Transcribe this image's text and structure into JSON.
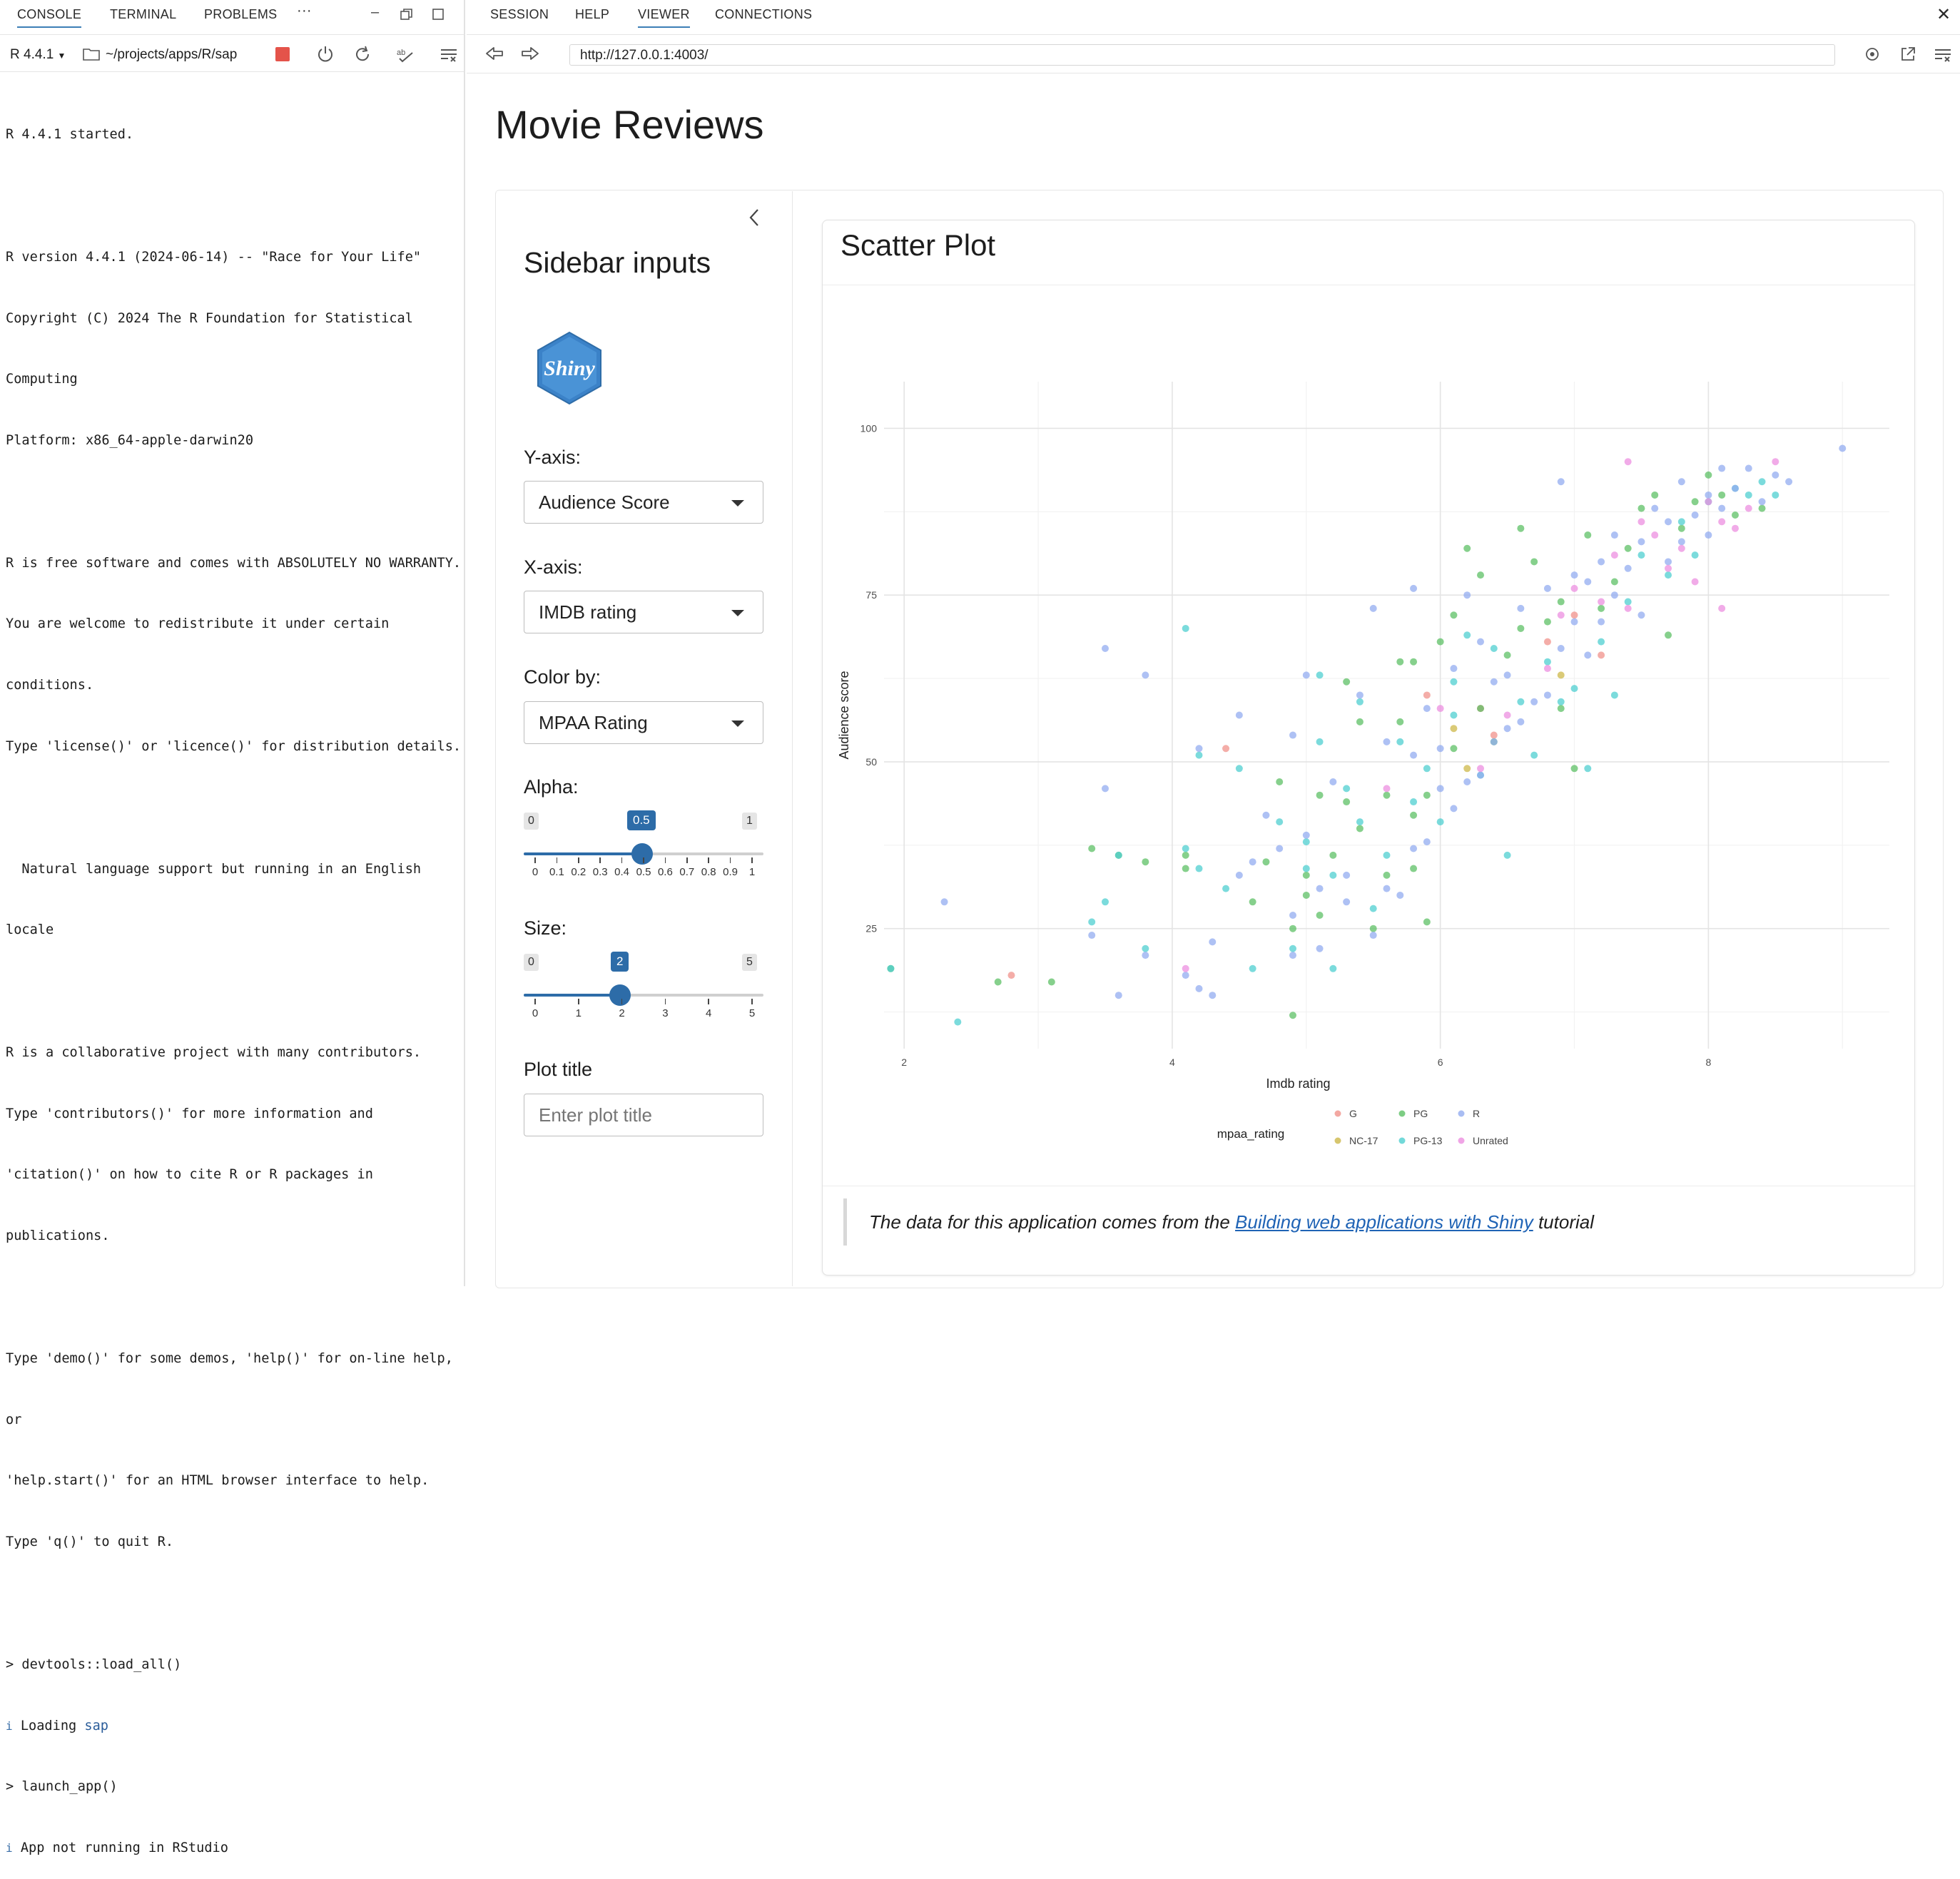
{
  "console_pane": {
    "tabs": [
      {
        "label": "CONSOLE",
        "active": true
      },
      {
        "label": "TERMINAL",
        "active": false
      },
      {
        "label": "PROBLEMS",
        "active": false
      }
    ],
    "more_label": "···",
    "r_version": "R 4.4.1",
    "path": "~/projects/apps/R/sap",
    "lines": [
      "R 4.4.1 started.",
      "",
      "R version 4.4.1 (2024-06-14) -- \"Race for Your Life\"",
      "Copyright (C) 2024 The R Foundation for Statistical",
      "Computing",
      "Platform: x86_64-apple-darwin20",
      "",
      "R is free software and comes with ABSOLUTELY NO WARRANTY.",
      "You are welcome to redistribute it under certain",
      "conditions.",
      "Type 'license()' or 'licence()' for distribution details.",
      "",
      "  Natural language support but running in an English",
      "locale",
      "",
      "R is a collaborative project with many contributors.",
      "Type 'contributors()' for more information and",
      "'citation()' on how to cite R or R packages in",
      "publications.",
      "",
      "Type 'demo()' for some demos, 'help()' for on-line help,",
      "or",
      "'help.start()' for an HTML browser interface to help.",
      "Type 'q()' to quit R.",
      "",
      "> devtools::load_all()"
    ],
    "loading_prefix": "Loading ",
    "loading_pkg": "sap",
    "launch_line": "> launch_app()",
    "app_msg": "App not running in RStudio",
    "info_glyph": "i"
  },
  "viewer": {
    "tabs": [
      {
        "label": "SESSION",
        "active": false
      },
      {
        "label": "HELP",
        "active": false
      },
      {
        "label": "VIEWER",
        "active": true
      },
      {
        "label": "CONNECTIONS",
        "active": false
      }
    ],
    "url": "http://127.0.0.1:4003/"
  },
  "app": {
    "title": "Movie Reviews",
    "sidebar": {
      "title": "Sidebar inputs",
      "logo_text": "Shiny",
      "y_axis": {
        "label": "Y-axis:",
        "value": "Audience Score"
      },
      "x_axis": {
        "label": "X-axis:",
        "value": "IMDB rating"
      },
      "color_by": {
        "label": "Color by:",
        "value": "MPAA Rating"
      },
      "alpha": {
        "label": "Alpha:",
        "min": "0",
        "max": "1",
        "value": "0.5",
        "ticks": [
          "0",
          "0.1",
          "0.2",
          "0.3",
          "0.4",
          "0.5",
          "0.6",
          "0.7",
          "0.8",
          "0.9",
          "1"
        ]
      },
      "size": {
        "label": "Size:",
        "min": "0",
        "max": "5",
        "value": "2",
        "ticks": [
          "0",
          "1",
          "2",
          "3",
          "4",
          "5"
        ]
      },
      "plot_title": {
        "label": "Plot title",
        "placeholder": "Enter plot title",
        "value": ""
      }
    },
    "card_title": "Scatter Plot",
    "footer": {
      "prefix": "The data for this application comes from the ",
      "link": "Building web applications with Shiny",
      "suffix": " tutorial"
    }
  },
  "colors": {
    "accent": "#2d6ca8",
    "G": "#f0928b",
    "NC-17": "#cdb84a",
    "PG": "#5dc065",
    "PG-13": "#4fcfd0",
    "R": "#93acf0",
    "Unrated": "#ec8fe0"
  },
  "chart_data": {
    "type": "scatter",
    "title": "",
    "xlabel": "Imdb rating",
    "ylabel": "Audience score",
    "xlim": [
      1.85,
      9.35
    ],
    "ylim": [
      7,
      107
    ],
    "x_ticks": [
      "2",
      "4",
      "6",
      "8"
    ],
    "y_ticks": [
      "25",
      "50",
      "75",
      "100"
    ],
    "legend_title": "mpaa_rating",
    "legend_position": "bottom",
    "legend": [
      "G",
      "NC-17",
      "PG",
      "PG-13",
      "R",
      "Unrated"
    ],
    "series": [
      {
        "name": "G",
        "points": [
          [
            2.8,
            18
          ],
          [
            4.4,
            52
          ],
          [
            5.9,
            60
          ],
          [
            6.3,
            58
          ],
          [
            6.4,
            54
          ],
          [
            6.8,
            68
          ],
          [
            7.0,
            72
          ],
          [
            7.2,
            66
          ]
        ]
      },
      {
        "name": "NC-17",
        "points": [
          [
            6.1,
            55
          ],
          [
            6.2,
            49
          ],
          [
            6.9,
            63
          ]
        ]
      },
      {
        "name": "PG",
        "points": [
          [
            1.9,
            19
          ],
          [
            2.7,
            17
          ],
          [
            3.1,
            17
          ],
          [
            3.4,
            37
          ],
          [
            3.6,
            36
          ],
          [
            3.8,
            35
          ],
          [
            4.1,
            36
          ],
          [
            4.1,
            34
          ],
          [
            4.6,
            29
          ],
          [
            4.7,
            35
          ],
          [
            4.8,
            47
          ],
          [
            4.9,
            25
          ],
          [
            4.9,
            12
          ],
          [
            5.0,
            33
          ],
          [
            5.0,
            30
          ],
          [
            5.1,
            27
          ],
          [
            5.1,
            45
          ],
          [
            5.2,
            36
          ],
          [
            5.3,
            44
          ],
          [
            5.3,
            62
          ],
          [
            5.4,
            56
          ],
          [
            5.4,
            40
          ],
          [
            5.5,
            25
          ],
          [
            5.6,
            45
          ],
          [
            5.6,
            33
          ],
          [
            5.7,
            56
          ],
          [
            5.7,
            65
          ],
          [
            5.8,
            65
          ],
          [
            5.8,
            42
          ],
          [
            5.8,
            34
          ],
          [
            5.9,
            26
          ],
          [
            5.9,
            45
          ],
          [
            6.0,
            68
          ],
          [
            6.1,
            72
          ],
          [
            6.1,
            52
          ],
          [
            6.2,
            82
          ],
          [
            6.3,
            78
          ],
          [
            6.3,
            58
          ],
          [
            6.4,
            53
          ],
          [
            6.5,
            66
          ],
          [
            6.6,
            70
          ],
          [
            6.6,
            85
          ],
          [
            6.7,
            80
          ],
          [
            6.8,
            71
          ],
          [
            6.9,
            74
          ],
          [
            6.9,
            58
          ],
          [
            7.0,
            49
          ],
          [
            7.1,
            84
          ],
          [
            7.2,
            73
          ],
          [
            7.3,
            77
          ],
          [
            7.4,
            82
          ],
          [
            7.5,
            88
          ],
          [
            7.6,
            90
          ],
          [
            7.7,
            69
          ],
          [
            7.8,
            85
          ],
          [
            7.9,
            89
          ],
          [
            8.0,
            93
          ],
          [
            8.1,
            90
          ],
          [
            8.2,
            87
          ],
          [
            8.4,
            88
          ]
        ]
      },
      {
        "name": "PG-13",
        "points": [
          [
            1.9,
            19
          ],
          [
            2.4,
            11
          ],
          [
            3.4,
            26
          ],
          [
            3.5,
            29
          ],
          [
            3.6,
            36
          ],
          [
            3.8,
            22
          ],
          [
            4.1,
            70
          ],
          [
            4.1,
            37
          ],
          [
            4.2,
            34
          ],
          [
            4.2,
            51
          ],
          [
            4.4,
            31
          ],
          [
            4.5,
            49
          ],
          [
            4.6,
            19
          ],
          [
            4.8,
            41
          ],
          [
            4.9,
            22
          ],
          [
            5.0,
            38
          ],
          [
            5.0,
            34
          ],
          [
            5.1,
            53
          ],
          [
            5.1,
            63
          ],
          [
            5.2,
            19
          ],
          [
            5.2,
            33
          ],
          [
            5.3,
            46
          ],
          [
            5.4,
            41
          ],
          [
            5.4,
            59
          ],
          [
            5.5,
            28
          ],
          [
            5.6,
            36
          ],
          [
            5.7,
            53
          ],
          [
            5.8,
            44
          ],
          [
            5.9,
            49
          ],
          [
            6.0,
            41
          ],
          [
            6.1,
            57
          ],
          [
            6.1,
            62
          ],
          [
            6.2,
            69
          ],
          [
            6.3,
            48
          ],
          [
            6.4,
            67
          ],
          [
            6.5,
            36
          ],
          [
            6.6,
            59
          ],
          [
            6.7,
            51
          ],
          [
            6.8,
            65
          ],
          [
            6.9,
            59
          ],
          [
            7.0,
            61
          ],
          [
            7.1,
            49
          ],
          [
            7.2,
            68
          ],
          [
            7.3,
            60
          ],
          [
            7.4,
            74
          ],
          [
            7.5,
            81
          ],
          [
            7.7,
            78
          ],
          [
            7.8,
            86
          ],
          [
            7.9,
            81
          ],
          [
            8.0,
            89
          ],
          [
            8.2,
            91
          ],
          [
            8.3,
            90
          ],
          [
            8.4,
            92
          ],
          [
            8.5,
            90
          ]
        ]
      },
      {
        "name": "R",
        "points": [
          [
            2.3,
            29
          ],
          [
            3.4,
            24
          ],
          [
            3.5,
            46
          ],
          [
            3.5,
            67
          ],
          [
            3.6,
            15
          ],
          [
            3.8,
            63
          ],
          [
            3.8,
            21
          ],
          [
            4.1,
            18
          ],
          [
            4.2,
            16
          ],
          [
            4.2,
            52
          ],
          [
            4.3,
            15
          ],
          [
            4.3,
            23
          ],
          [
            4.5,
            33
          ],
          [
            4.6,
            35
          ],
          [
            4.7,
            42
          ],
          [
            4.8,
            37
          ],
          [
            4.9,
            27
          ],
          [
            4.9,
            21
          ],
          [
            5.0,
            39
          ],
          [
            5.1,
            22
          ],
          [
            5.1,
            31
          ],
          [
            5.2,
            47
          ],
          [
            5.3,
            29
          ],
          [
            5.3,
            33
          ],
          [
            5.4,
            60
          ],
          [
            5.5,
            73
          ],
          [
            5.5,
            24
          ],
          [
            5.6,
            31
          ],
          [
            5.6,
            53
          ],
          [
            5.7,
            30
          ],
          [
            5.8,
            51
          ],
          [
            5.8,
            37
          ],
          [
            5.9,
            58
          ],
          [
            5.9,
            38
          ],
          [
            6.0,
            46
          ],
          [
            6.0,
            52
          ],
          [
            6.1,
            43
          ],
          [
            6.1,
            64
          ],
          [
            6.2,
            47
          ],
          [
            6.2,
            75
          ],
          [
            6.3,
            48
          ],
          [
            6.3,
            68
          ],
          [
            6.4,
            53
          ],
          [
            6.4,
            62
          ],
          [
            6.5,
            55
          ],
          [
            6.5,
            63
          ],
          [
            6.6,
            73
          ],
          [
            6.6,
            56
          ],
          [
            6.7,
            59
          ],
          [
            6.8,
            60
          ],
          [
            6.8,
            76
          ],
          [
            6.9,
            67
          ],
          [
            7.0,
            71
          ],
          [
            7.0,
            78
          ],
          [
            7.1,
            77
          ],
          [
            7.1,
            66
          ],
          [
            7.2,
            80
          ],
          [
            7.2,
            71
          ],
          [
            7.3,
            84
          ],
          [
            7.3,
            75
          ],
          [
            7.4,
            79
          ],
          [
            7.5,
            83
          ],
          [
            7.5,
            72
          ],
          [
            7.6,
            88
          ],
          [
            7.7,
            86
          ],
          [
            7.7,
            80
          ],
          [
            7.8,
            92
          ],
          [
            7.8,
            83
          ],
          [
            7.9,
            87
          ],
          [
            8.0,
            90
          ],
          [
            8.0,
            84
          ],
          [
            8.1,
            94
          ],
          [
            8.1,
            88
          ],
          [
            8.2,
            91
          ],
          [
            8.3,
            94
          ],
          [
            8.4,
            89
          ],
          [
            8.5,
            93
          ],
          [
            8.6,
            92
          ],
          [
            9.0,
            97
          ],
          [
            6.9,
            92
          ],
          [
            5.8,
            76
          ],
          [
            5.0,
            63
          ],
          [
            4.9,
            54
          ],
          [
            4.5,
            57
          ]
        ]
      },
      {
        "name": "Unrated",
        "points": [
          [
            4.1,
            19
          ],
          [
            5.6,
            46
          ],
          [
            6.0,
            58
          ],
          [
            6.3,
            49
          ],
          [
            6.5,
            57
          ],
          [
            6.8,
            64
          ],
          [
            6.9,
            72
          ],
          [
            7.0,
            76
          ],
          [
            7.2,
            74
          ],
          [
            7.3,
            81
          ],
          [
            7.4,
            73
          ],
          [
            7.5,
            86
          ],
          [
            7.6,
            84
          ],
          [
            7.7,
            79
          ],
          [
            7.8,
            82
          ],
          [
            7.9,
            77
          ],
          [
            8.0,
            89
          ],
          [
            8.1,
            86
          ],
          [
            8.2,
            85
          ],
          [
            8.3,
            88
          ],
          [
            8.5,
            95
          ],
          [
            8.1,
            73
          ],
          [
            7.4,
            95
          ]
        ]
      }
    ]
  }
}
